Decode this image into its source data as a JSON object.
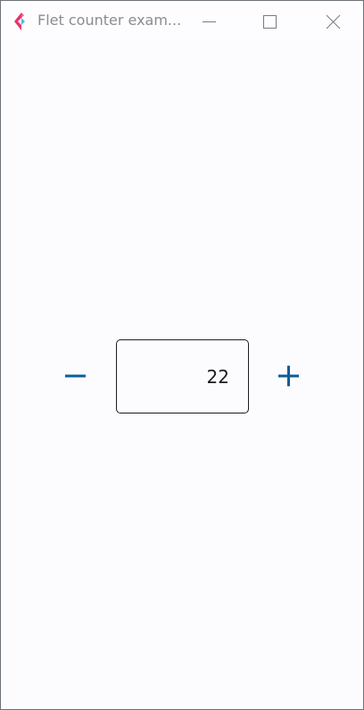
{
  "window": {
    "title": "Flet counter exam...",
    "icon": "flet-logo-icon",
    "controls": [
      "minimize-icon",
      "maximize-icon",
      "close-icon"
    ]
  },
  "counter": {
    "value": "22",
    "decrement_icon": "minus-icon",
    "increment_icon": "plus-icon"
  },
  "colors": {
    "accent": "#0b5d9a",
    "background": "#fcfbfe",
    "logo_pink": "#e8336b",
    "logo_cyan": "#3fc0dd"
  }
}
